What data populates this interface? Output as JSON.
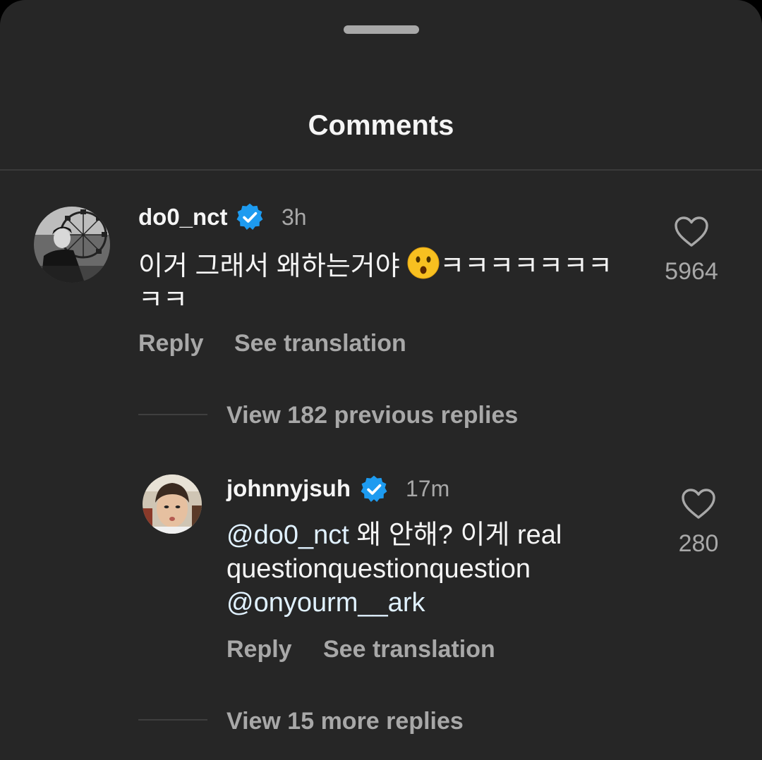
{
  "sheet": {
    "title": "Comments"
  },
  "colors": {
    "background": "#262626",
    "verified": "#1d9bf0",
    "text_primary": "#f5f5f5",
    "text_secondary": "#a8a8a8"
  },
  "comment": {
    "username": "do0_nct",
    "time": "3h",
    "text_before_emoji": "이거 그래서 왜하는거야 ",
    "emoji": "hushed-face",
    "text_after_emoji": "ㅋㅋㅋㅋㅋㅋㅋ",
    "text_line2": "ㅋㅋ",
    "reply_label": "Reply",
    "translate_label": "See translation",
    "like_count": "5964",
    "view_previous": "View 182 previous replies"
  },
  "reply": {
    "username": "johnnyjsuh",
    "time": "17m",
    "mention1": "@do0_nct",
    "text1": " 왜 안해? 이게 real",
    "text2": "questionquestionquestion",
    "mention2": "@onyourm__ark",
    "reply_label": "Reply",
    "translate_label": "See translation",
    "like_count": "280",
    "view_more": "View 15 more replies"
  }
}
